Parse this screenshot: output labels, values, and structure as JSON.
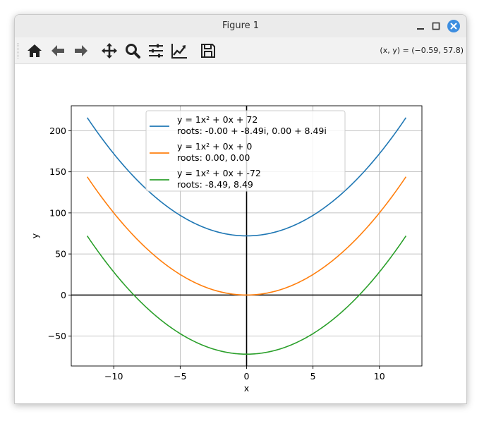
{
  "window": {
    "title": "Figure 1"
  },
  "toolbar": {
    "tools": [
      {
        "name": "home-button",
        "icon": "home-icon"
      },
      {
        "name": "back-button",
        "icon": "arrow-left-icon"
      },
      {
        "name": "forward-button",
        "icon": "arrow-right-icon"
      },
      {
        "name": "pan-button",
        "icon": "move-arrows-icon"
      },
      {
        "name": "zoom-button",
        "icon": "magnifier-icon"
      },
      {
        "name": "configure-subplots-button",
        "icon": "sliders-icon"
      },
      {
        "name": "edit-axis-button",
        "icon": "line-chart-icon"
      },
      {
        "name": "save-button",
        "icon": "floppy-disk-icon"
      }
    ],
    "coords": "(x, y) = (−0.59, 57.8)"
  },
  "colors": {
    "titlebar": "#ebebeb",
    "toolbar": "#f2f2f2",
    "close_button": "#3d8ee0",
    "icon": "#222222",
    "grid": "#b0b0b0"
  },
  "chart_data": {
    "type": "line",
    "xlabel": "x",
    "ylabel": "y",
    "xlim": [
      -13.2,
      13.2
    ],
    "ylim": [
      -86.4,
      230.4
    ],
    "xticks": [
      -10,
      -5,
      0,
      5,
      10
    ],
    "xtick_labels": [
      "−10",
      "−5",
      "0",
      "5",
      "10"
    ],
    "yticks": [
      -50,
      0,
      50,
      100,
      150,
      200
    ],
    "ytick_labels": [
      "−50",
      "0",
      "50",
      "100",
      "150",
      "200"
    ],
    "grid": true,
    "legend_position": "upper-center",
    "x_range": [
      -12,
      12
    ],
    "series": [
      {
        "name": "y = 1x² + 0x + 72",
        "roots": "roots: -0.00 + -8.49i, 0.00 + 8.49i",
        "a": 1,
        "b": 0,
        "c": 72,
        "color": "#1f77b4"
      },
      {
        "name": "y = 1x² + 0x + 0",
        "roots": "roots: 0.00, 0.00",
        "a": 1,
        "b": 0,
        "c": 0,
        "color": "#ff7f0e"
      },
      {
        "name": "y = 1x² + 0x + -72",
        "roots": "roots: -8.49, 8.49",
        "a": 1,
        "b": 0,
        "c": -72,
        "color": "#2ca02c"
      }
    ]
  }
}
